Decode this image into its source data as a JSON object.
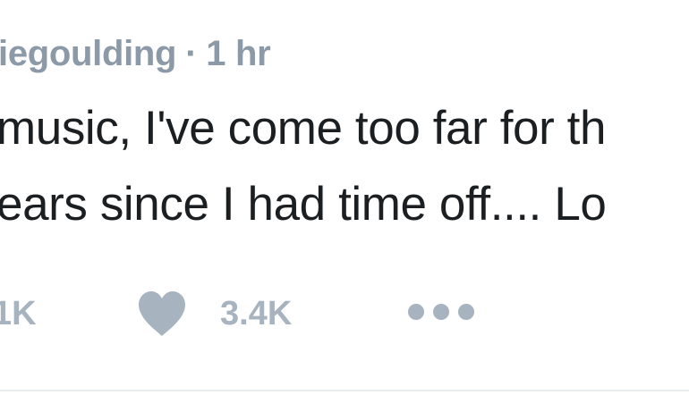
{
  "tweet": {
    "handle": "iegoulding",
    "separator": "·",
    "time": "1 hr",
    "text_line1": "music, I've come too far for th",
    "text_line2": "ears since I had time off.... Lo"
  },
  "actions": {
    "retweet_count": "1K",
    "like_count": "3.4K"
  },
  "icons": {
    "like": "heart-icon",
    "more": "more-dots-icon"
  },
  "colors": {
    "text": "#1c1f22",
    "meta": "#8c99a6",
    "icon": "#a7b3bf",
    "divider": "#e6ecf0"
  }
}
